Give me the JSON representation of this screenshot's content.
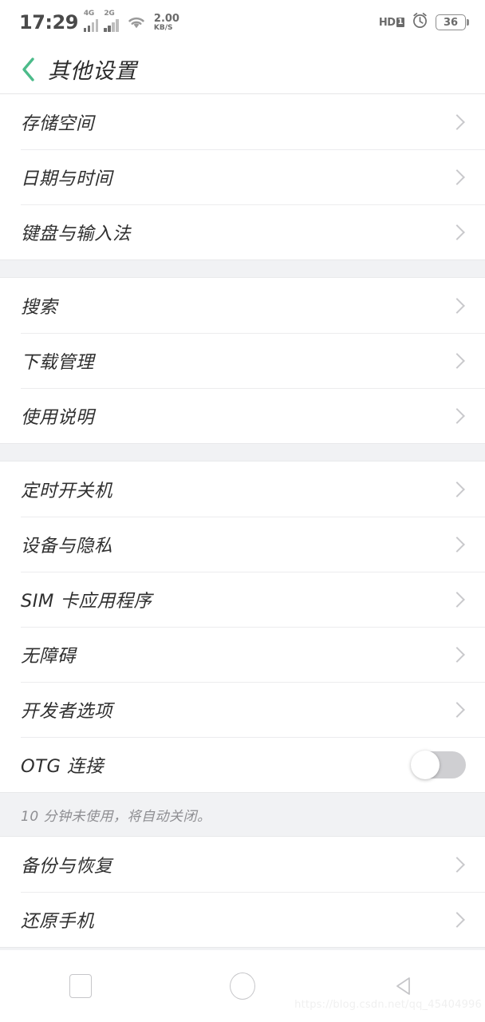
{
  "status_bar": {
    "time": "17:29",
    "signal_1_label": "4G",
    "signal_2_label": "2G",
    "wifi_icon": "wifi-icon",
    "net_speed_value": "2.00",
    "net_speed_unit": "KB/S",
    "volte_label": "HD",
    "volte_badge": "1",
    "alarm_icon": "alarm-clock-icon",
    "battery_percent": "36"
  },
  "header": {
    "back_icon": "back-chevron-icon",
    "title": "其他设置",
    "accent_color": "#4cbb8a"
  },
  "list": {
    "groups": [
      {
        "rows": [
          {
            "label": "存储空间",
            "accessory": "chevron"
          },
          {
            "label": "日期与时间",
            "accessory": "chevron"
          },
          {
            "label": "键盘与输入法",
            "accessory": "chevron"
          }
        ]
      },
      {
        "rows": [
          {
            "label": "搜索",
            "accessory": "chevron"
          },
          {
            "label": "下载管理",
            "accessory": "chevron"
          },
          {
            "label": "使用说明",
            "accessory": "chevron"
          }
        ]
      },
      {
        "rows": [
          {
            "label": "定时开关机",
            "accessory": "chevron"
          },
          {
            "label": "设备与隐私",
            "accessory": "chevron"
          },
          {
            "label": "SIM 卡应用程序",
            "accessory": "chevron"
          },
          {
            "label": "无障碍",
            "accessory": "chevron"
          },
          {
            "label": "开发者选项",
            "accessory": "chevron"
          },
          {
            "label": "OTG 连接",
            "accessory": "toggle",
            "toggle_on": false
          }
        ],
        "footer_hint": "10 分钟未使用，将自动关闭。"
      },
      {
        "rows": [
          {
            "label": "备份与恢复",
            "accessory": "chevron"
          },
          {
            "label": "还原手机",
            "accessory": "chevron"
          }
        ]
      }
    ]
  },
  "nav_bar": {
    "recents_icon": "square-recents-icon",
    "home_icon": "circle-home-icon",
    "back_icon": "triangle-back-icon"
  },
  "watermark": "https://blog.csdn.net/qq_45404996"
}
